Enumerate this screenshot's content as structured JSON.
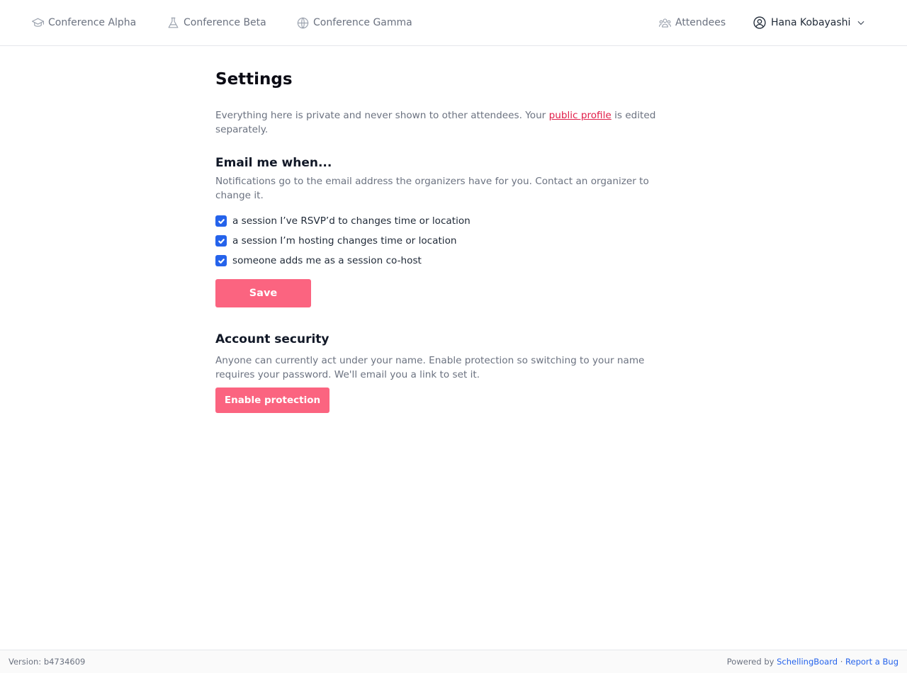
{
  "nav": {
    "items": [
      {
        "label": "Conference Alpha",
        "icon": "graduation-cap-icon"
      },
      {
        "label": "Conference Beta",
        "icon": "flask-icon"
      },
      {
        "label": "Conference Gamma",
        "icon": "globe-icon"
      }
    ],
    "attendees": {
      "label": "Attendees",
      "icon": "user-group-icon"
    },
    "user": {
      "name": "Hana Kobayashi",
      "icon": "user-circle-icon",
      "menu_icon": "chevron-down-icon"
    }
  },
  "settings": {
    "title": "Settings",
    "intro_before": "Everything here is private and never shown to other attendees. Your ",
    "intro_link": "public profile",
    "intro_after": " is edited separately.",
    "email": {
      "title": "Email me when...",
      "description": "Notifications go to the email address the organizers have for you. Contact an organizer to change it.",
      "options": [
        {
          "label": "a session I’ve RSVP’d to changes time or location",
          "checked": true
        },
        {
          "label": "a session I’m hosting changes time or location",
          "checked": true
        },
        {
          "label": "someone adds me as a session co-host",
          "checked": true
        }
      ],
      "save_label": "Save"
    },
    "security": {
      "title": "Account security",
      "description": "Anyone can currently act under your name. Enable protection so switching to your name requires your password. We'll email you a link to set it.",
      "button_label": "Enable protection"
    }
  },
  "footer": {
    "version": "Version: b4734609",
    "powered_by": "Powered by",
    "brand_link": "SchellingBoard",
    "separator": "·",
    "bug_link": "Report a Bug"
  },
  "colors": {
    "accent_button": "#fb6480",
    "link_pink": "#e11d48",
    "checkbox_blue": "#2563eb",
    "footer_link": "#2563eb"
  }
}
